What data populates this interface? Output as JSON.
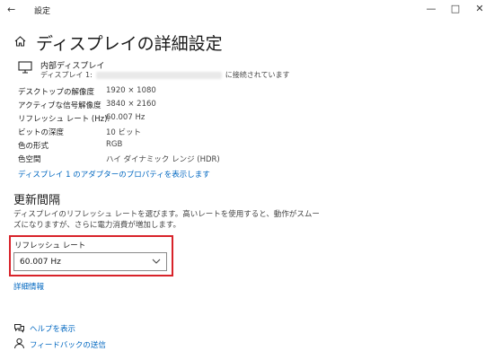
{
  "window": {
    "title": "設定",
    "back_icon": "back-arrow-icon",
    "controls": {
      "minimize": "—",
      "maximize": "□",
      "close": "✕"
    }
  },
  "header": {
    "icon": "home-icon",
    "title": "ディスプレイの詳細設定"
  },
  "display": {
    "icon": "monitor-icon",
    "name": "内部ディスプレイ",
    "connection_prefix": "ディスプレイ 1:",
    "connection_suffix": "に接続されています"
  },
  "info": [
    {
      "label": "デスクトップの解像度",
      "value": "1920 × 1080"
    },
    {
      "label": "アクティブな信号解像度",
      "value": "3840 × 2160"
    },
    {
      "label": "リフレッシュ レート (Hz):",
      "value": "60.007 Hz"
    },
    {
      "label": "ビットの深度",
      "value": "10 ビット"
    },
    {
      "label": "色の形式",
      "value": "RGB"
    },
    {
      "label": "色空間",
      "value": "ハイ ダイナミック レンジ (HDR)"
    }
  ],
  "adapter_link": "ディスプレイ 1 のアダプターのプロパティを表示します",
  "refresh_section": {
    "title": "更新間隔",
    "description": "ディスプレイのリフレッシュ レートを選びます。高いレートを使用すると、動作がスムーズになりますが、さらに電力消費が増加します。",
    "label": "リフレッシュ レート",
    "selected": "60.007 Hz",
    "highlight_color": "#d8232a"
  },
  "advanced_link": "詳細情報",
  "bottom_links": [
    {
      "icon": "help-icon",
      "label": "ヘルプを表示"
    },
    {
      "icon": "feedback-icon",
      "label": "フィードバックの送信"
    }
  ],
  "colors": {
    "accent": "#0067c0"
  }
}
